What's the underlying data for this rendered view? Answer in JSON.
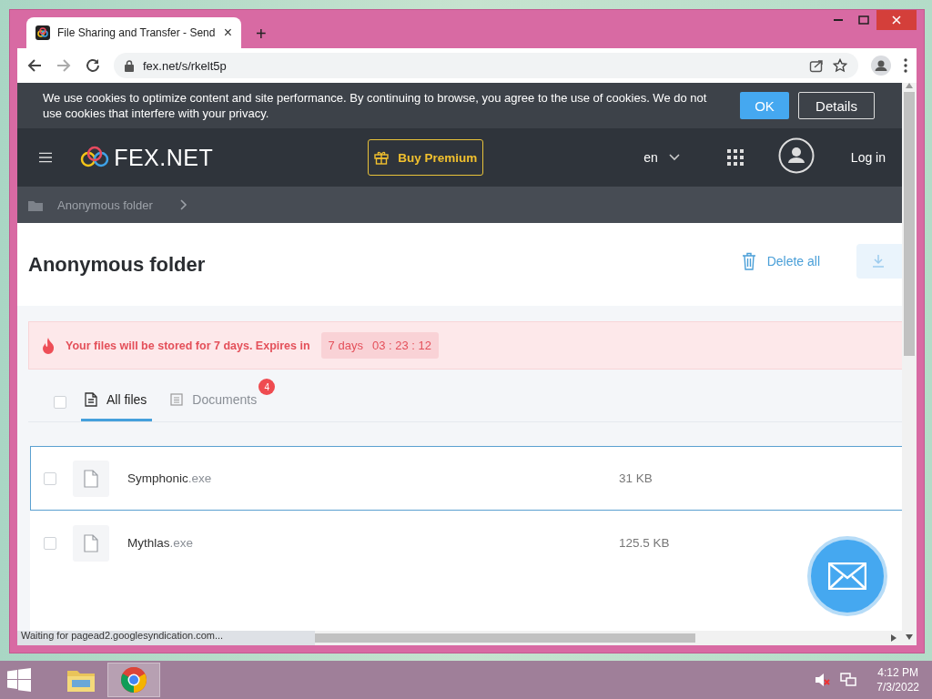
{
  "browser": {
    "tab": {
      "title": "File Sharing and Transfer - Send",
      "close": "×"
    },
    "new_tab": "+",
    "address": "fex.net/s/rkelt5p",
    "status": "Waiting for pagead2.googlesyndication.com..."
  },
  "cookie_bar": {
    "text": "We use cookies to optimize content and site performance. By continuing to browse, you agree to the use of cookies. We do not use cookies that interfere with your privacy.",
    "ok": "OK",
    "details": "Details"
  },
  "header": {
    "logo": "FEX.NET",
    "premium": "Buy Premium",
    "language": "en",
    "login": "Log in"
  },
  "breadcrumb": [
    {
      "label": "Anonymous folder"
    }
  ],
  "folder": {
    "title": "Anonymous folder",
    "delete_all": "Delete all"
  },
  "alert": {
    "text": "Your files will be stored for 7 days. Expires in",
    "days": "7 days",
    "time": "03 : 23 : 12"
  },
  "select_all": {
    "checked": false
  },
  "tabs": [
    {
      "label": "All files",
      "selected": true
    },
    {
      "label": "Documents",
      "selected": false,
      "badge": "4"
    }
  ],
  "files": [
    {
      "name": "Symphonic",
      "ext": ".exe",
      "size": "31 KB",
      "selected": true,
      "checked": false
    },
    {
      "name": "Mythlas",
      "ext": ".exe",
      "size": "125.5 KB",
      "selected": false,
      "checked": false
    }
  ],
  "taskbar": {
    "apps": [
      {
        "kind": "explorer",
        "active": false
      },
      {
        "kind": "chrome",
        "active": true
      }
    ],
    "time": "4:12 PM",
    "date": "7/3/2022"
  }
}
